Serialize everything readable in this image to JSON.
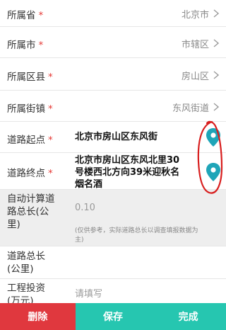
{
  "fields": {
    "province": {
      "label": "所属省",
      "required_mark": "*",
      "value": "北京市"
    },
    "city": {
      "label": "所属市",
      "required_mark": "*",
      "value": "市辖区"
    },
    "district": {
      "label": "所属区县",
      "required_mark": "*",
      "value": "房山区"
    },
    "street": {
      "label": "所属街镇",
      "required_mark": "*",
      "value": "东风街道"
    },
    "road_start": {
      "label": "道路起点",
      "required_mark": "*",
      "value": "北京市房山区东风街"
    },
    "road_end": {
      "label": "道路终点",
      "required_mark": "*",
      "value_lines": [
        "北京市房山区东风北里30",
        "号楼西北方向39米迎秋名",
        "烟名酒"
      ]
    },
    "auto_length": {
      "label_lines": [
        "自动计算道",
        "路总长(公",
        "里)"
      ],
      "value": "0.10",
      "note_lines": [
        "(仅供参考，实际道路总长以调查填报数据为",
        "主)"
      ]
    },
    "total_length": {
      "label_lines": [
        "道路总长",
        "(公里)"
      ]
    },
    "investment": {
      "label_lines": [
        "工程投资",
        "(万元)"
      ],
      "placeholder": "请填写"
    }
  },
  "buttons": {
    "delete": {
      "label": "删除",
      "color": "#e0383e"
    },
    "save": {
      "label": "保存",
      "color": "#26c6b0"
    },
    "finish": {
      "label": "完成",
      "color": "#26c6b0"
    }
  },
  "colors": {
    "required": "#e53935",
    "pin": "#1fa5b8",
    "annotation": "#d81e1e"
  },
  "icons": [
    "chevron-right-icon",
    "location-pin-icon"
  ]
}
